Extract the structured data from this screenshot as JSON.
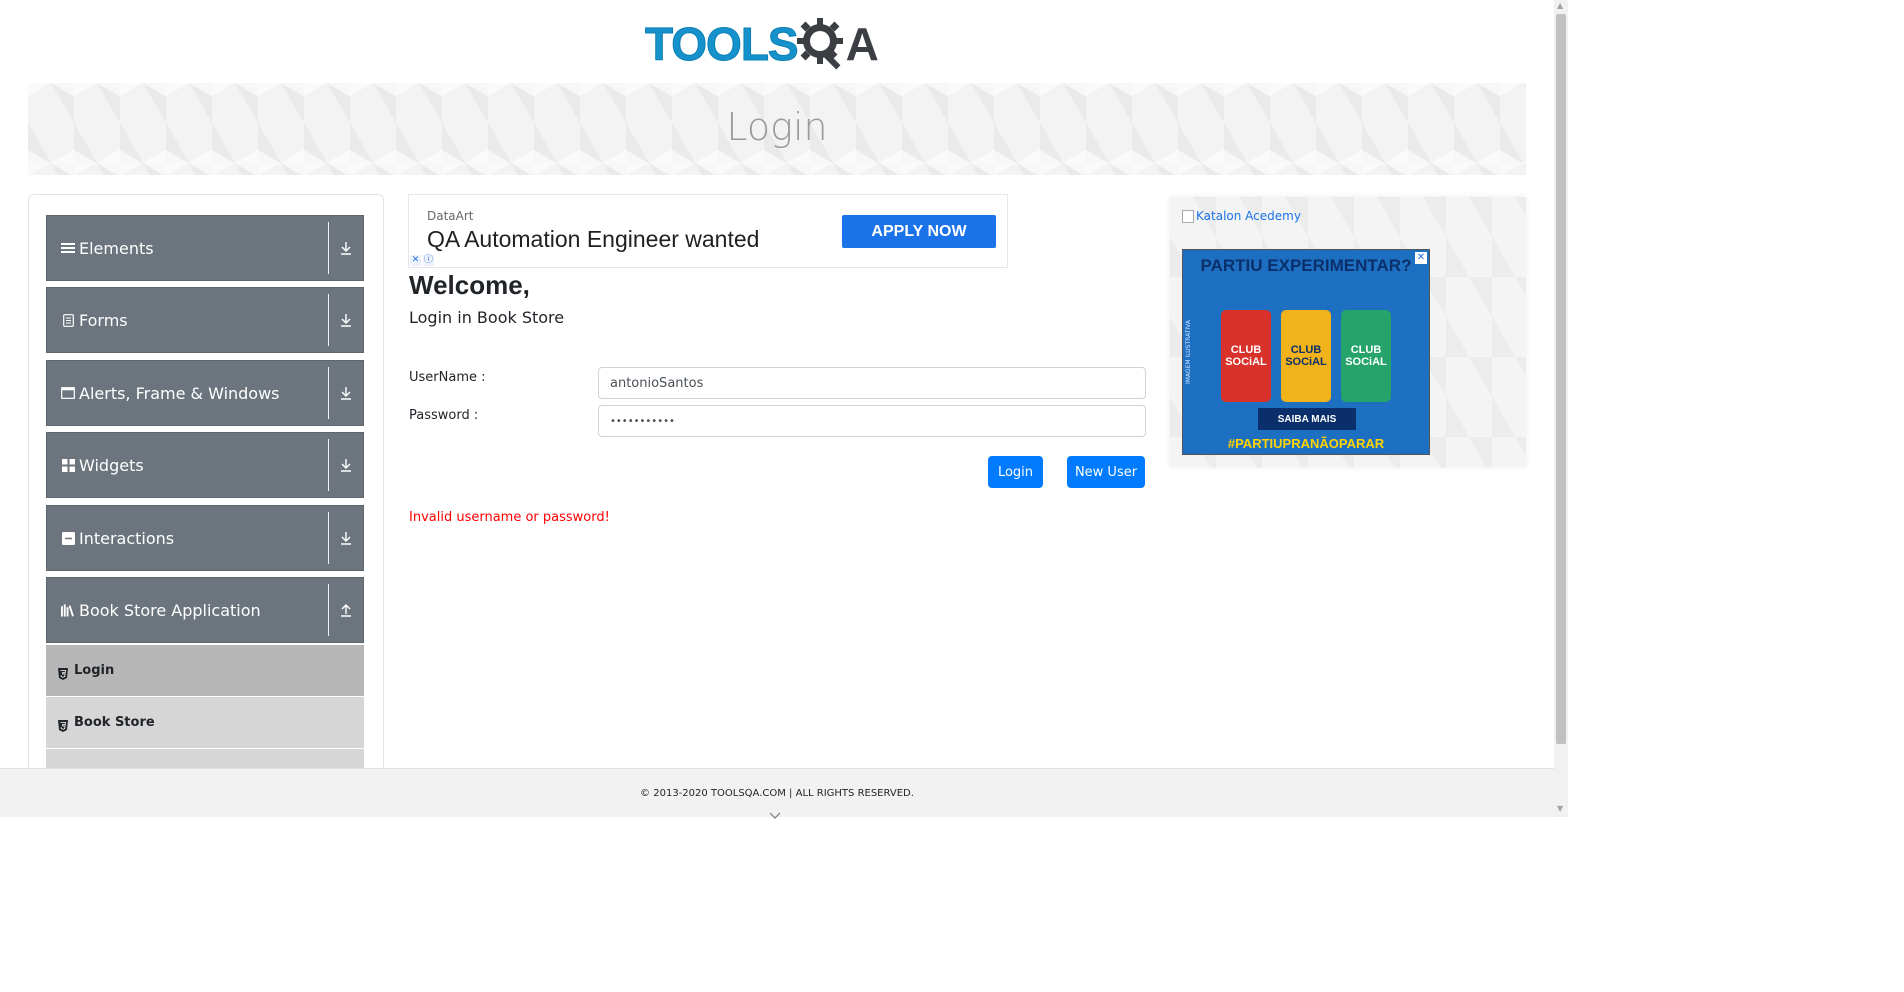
{
  "header": {
    "logo_part1": "TOOLS",
    "logo_part2": "A",
    "logo_icon": "gear-magnifier-icon",
    "banner_title": "Login"
  },
  "sidebar": {
    "groups": [
      {
        "label": "Elements",
        "icon": "menu-icon",
        "toggle": "download-arrow-icon"
      },
      {
        "label": "Forms",
        "icon": "document-icon",
        "toggle": "download-arrow-icon"
      },
      {
        "label": "Alerts, Frame & Windows",
        "icon": "window-icon",
        "toggle": "download-arrow-icon"
      },
      {
        "label": "Widgets",
        "icon": "grid-icon",
        "toggle": "download-arrow-icon"
      },
      {
        "label": "Interactions",
        "icon": "interaction-icon",
        "toggle": "download-arrow-icon"
      },
      {
        "label": "Book Store Application",
        "icon": "books-icon",
        "toggle": "upload-arrow-icon"
      }
    ],
    "sub_items": [
      {
        "label": "Login",
        "active": true,
        "icon": "html5-icon"
      },
      {
        "label": "Book Store",
        "active": false,
        "icon": "html5-icon"
      }
    ]
  },
  "ad_top": {
    "company": "DataArt",
    "headline": "QA Automation Engineer wanted",
    "button": "APPLY NOW",
    "close_glyph": "✕",
    "info_glyph": "ⓘ"
  },
  "main": {
    "welcome": "Welcome,",
    "subtitle": "Login in Book Store",
    "username_label": "UserName :",
    "username_value": "antonioSantos",
    "password_label": "Password :",
    "password_value": "•••••••••••",
    "login_button": "Login",
    "new_user_button": "New User",
    "error": "Invalid username or password!"
  },
  "ad_right": {
    "broken_image_alt": "Katalon Acedemy",
    "promo_title": "PARTIU EXPERIMENTAR?",
    "pack_label": "CLUB SOCiAL",
    "promo_button": "SAIBA MAIS",
    "promo_tag": "#PARTIUPRANÃOPARAR",
    "promo_side": "IMAGEM ILUSTRATIVA",
    "close_glyph": "✕"
  },
  "footer": {
    "copyright": "© 2013-2020 TOOLSQA.COM | ALL RIGHTS RESERVED."
  },
  "colors": {
    "brand_blue": "#1592cc",
    "sidebar_group": "#6c757d",
    "primary_button": "#007bff",
    "error": "#ff0000",
    "ad_button": "#1a73e8"
  }
}
